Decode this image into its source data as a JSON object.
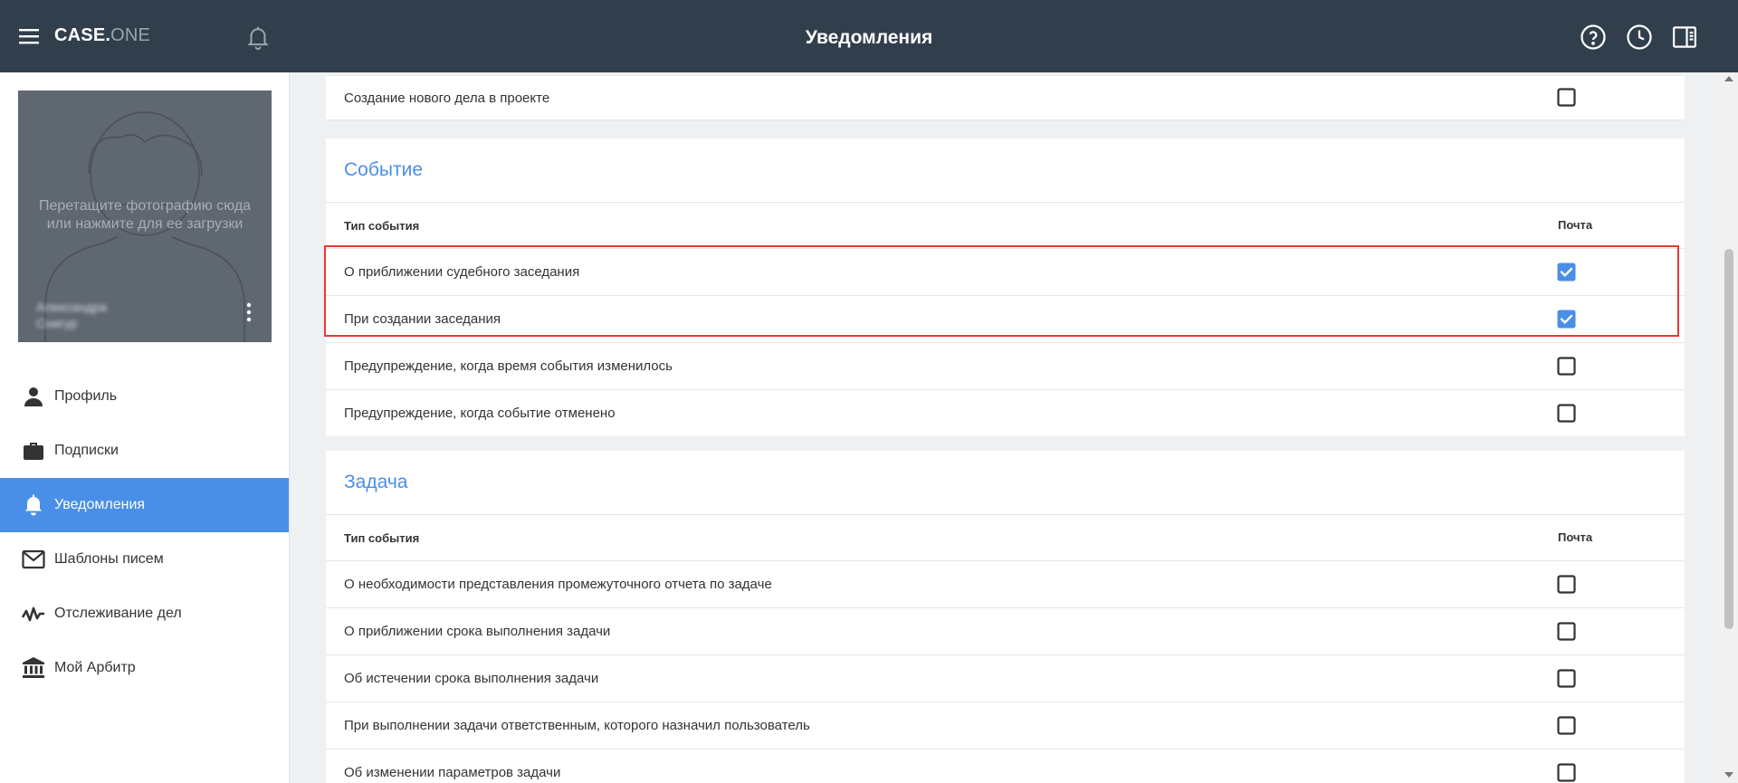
{
  "header": {
    "logo_main": "CASE.",
    "logo_suffix": "ONE",
    "title": "Уведомления"
  },
  "profile": {
    "photo_hint": "Перетащите фотографию сюда или нажмите для ее загрузки",
    "name": "Александра\nСнигур"
  },
  "sidebar": {
    "items": [
      {
        "label": "Профиль",
        "icon": "person-icon"
      },
      {
        "label": "Подписки",
        "icon": "briefcase-icon"
      },
      {
        "label": "Уведомления",
        "icon": "bell-icon"
      },
      {
        "label": "Шаблоны писем",
        "icon": "mail-icon"
      },
      {
        "label": "Отслеживание дел",
        "icon": "activity-icon"
      },
      {
        "label": "Мой Арбитр",
        "icon": "bank-icon"
      }
    ],
    "active_index": 2
  },
  "sections": {
    "project": {
      "rows": [
        {
          "label": "Создание нового дела в проекте",
          "checked": false
        }
      ]
    },
    "event": {
      "title": "Событие",
      "col_type": "Тип события",
      "col_mail": "Почта",
      "rows": [
        {
          "label": "О приближении судебного заседания",
          "checked": true
        },
        {
          "label": "При создании заседания",
          "checked": true
        },
        {
          "label": "Предупреждение, когда время события изменилось",
          "checked": false
        },
        {
          "label": "Предупреждение, когда событие отменено",
          "checked": false
        }
      ]
    },
    "task": {
      "title": "Задача",
      "col_type": "Тип события",
      "col_mail": "Почта",
      "rows": [
        {
          "label": "О необходимости представления промежуточного отчета по задаче",
          "checked": false
        },
        {
          "label": "О приближении срока выполнения задачи",
          "checked": false
        },
        {
          "label": "Об истечении срока выполнения задачи",
          "checked": false
        },
        {
          "label": "При выполнении задачи ответственным, которого назначил пользователь",
          "checked": false
        },
        {
          "label": "Об изменении параметров задачи",
          "checked": false
        }
      ]
    }
  },
  "colors": {
    "header_bg": "#313f4c",
    "accent": "#4a8fe7",
    "highlight": "#e53935"
  }
}
